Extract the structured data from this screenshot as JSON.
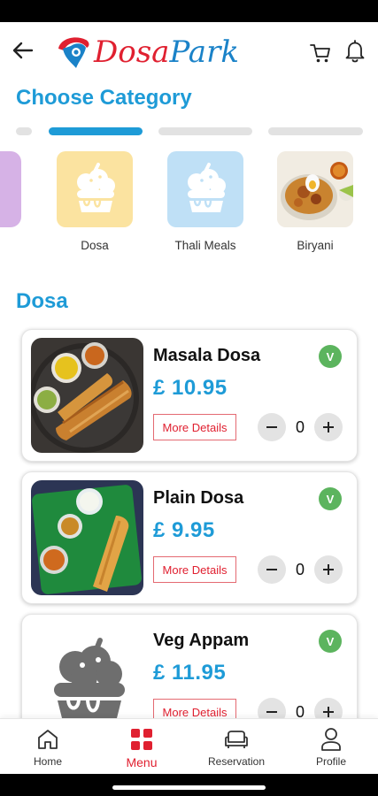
{
  "header": {
    "logo_text_1": "Dosa",
    "logo_text_2": "Park"
  },
  "category_section": {
    "title": "Choose Category"
  },
  "categories": [
    {
      "label": "Dosa",
      "icon": "food-bowl-icon",
      "bg": "#fbe3a0"
    },
    {
      "label": "Thali Meals",
      "icon": "food-bowl-icon",
      "bg": "#bfe0f6"
    },
    {
      "label": "Biryani",
      "icon": "biryani-photo"
    }
  ],
  "dish_section": {
    "title": "Dosa"
  },
  "dishes": [
    {
      "name": "Masala Dosa",
      "price": "£ 10.95",
      "veg": "V",
      "more": "More Details",
      "qty": "0"
    },
    {
      "name": "Plain Dosa",
      "price": "£ 9.95",
      "veg": "V",
      "more": "More Details",
      "qty": "0"
    },
    {
      "name": "Veg Appam",
      "price": "£ 11.95",
      "veg": "V",
      "more": "More Details",
      "qty": "0"
    }
  ],
  "nav": [
    {
      "label": "Home",
      "icon": "home-icon"
    },
    {
      "label": "Menu",
      "icon": "grid-icon"
    },
    {
      "label": "Reservation",
      "icon": "sofa-icon"
    },
    {
      "label": "Profile",
      "icon": "person-icon"
    }
  ],
  "colors": {
    "accent": "#1e9bd7",
    "brand_red": "#e02030",
    "veg_green": "#5cb45e"
  }
}
